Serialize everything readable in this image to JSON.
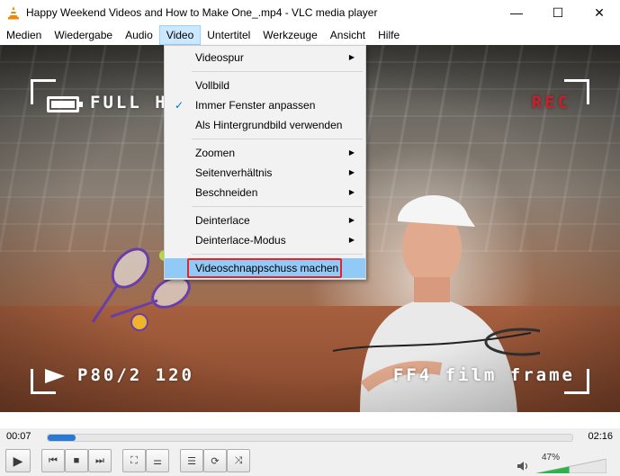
{
  "window": {
    "title": "Happy Weekend Videos and How to Make One_.mp4 - VLC media player",
    "controls": {
      "minimize": "—",
      "maximize": "☐",
      "close": "✕"
    }
  },
  "menubar": {
    "items": [
      {
        "label": "Medien"
      },
      {
        "label": "Wiedergabe"
      },
      {
        "label": "Audio"
      },
      {
        "label": "Video",
        "active": true
      },
      {
        "label": "Untertitel"
      },
      {
        "label": "Werkzeuge"
      },
      {
        "label": "Ansicht"
      },
      {
        "label": "Hilfe"
      }
    ]
  },
  "video_menu": {
    "items": [
      {
        "label": "Videospur",
        "submenu": true
      },
      {
        "label": "Vollbild"
      },
      {
        "label": "Immer Fenster anpassen",
        "checked": true
      },
      {
        "label": "Als Hintergrundbild verwenden"
      },
      {
        "label": "Zoomen",
        "submenu": true
      },
      {
        "label": "Seitenverhältnis",
        "submenu": true
      },
      {
        "label": "Beschneiden",
        "submenu": true
      },
      {
        "label": "Deinterlace",
        "submenu": true
      },
      {
        "label": "Deinterlace-Modus",
        "submenu": true
      },
      {
        "label": "Videoschnappschuss machen",
        "highlighted": true
      }
    ]
  },
  "video_overlay": {
    "top_left": "FULL H",
    "top_right": "REC",
    "bottom_left": "P80/2 120",
    "bottom_right": "FF4 film frame"
  },
  "playback": {
    "elapsed": "00:07",
    "total": "02:16",
    "progress_fraction": 0.054,
    "volume_label": "47%",
    "volume_fraction": 0.47
  },
  "icons": {
    "play": "▶",
    "previous": "⏮",
    "stop": "■",
    "next": "⏭",
    "fullscreen": "⛶",
    "extended_settings": "⚌",
    "playlist": "☰",
    "loop": "⟳",
    "shuffle": "⤨",
    "speaker": "🔈",
    "submenu_arrow": "▶",
    "check": "✓"
  },
  "colors": {
    "menu_highlight": "#91c9f7",
    "snapshot_outline": "#e0262b",
    "rec_text": "#c8202a",
    "seek_fill": "#2b79d2",
    "volume_fill": "#2fb24c"
  }
}
